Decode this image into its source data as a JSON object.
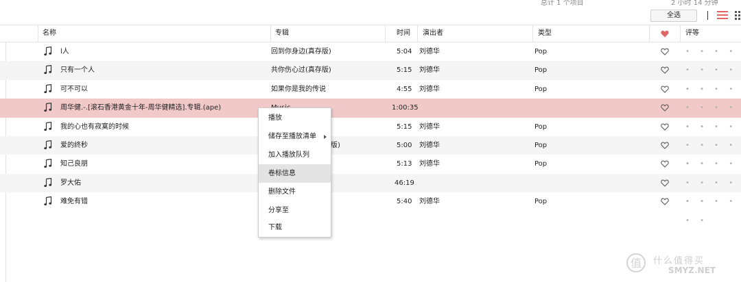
{
  "topbar": {
    "status_left": "总计 1 个项目",
    "status_right": "2 小时 14 分钟",
    "select_all_label": "全选"
  },
  "columns": {
    "name": "名称",
    "album": "专辑",
    "time": "时间",
    "artist": "演出者",
    "genre": "类型",
    "rating": "评等"
  },
  "rows": [
    {
      "title": "l人",
      "album": "回到你身边(真存版)",
      "time": "5:04",
      "artist": "刘德华",
      "genre": "Pop"
    },
    {
      "title": "只有一个人",
      "album": "共你伤心过(真存版)",
      "time": "5:15",
      "artist": "刘德华",
      "genre": "Pop"
    },
    {
      "title": "可不可以",
      "album": "如果你是我的传说",
      "time": "4:55",
      "artist": "刘德华",
      "genre": "Pop"
    },
    {
      "title": "周华健.-.[滚石香港黄金十年-周华健精选].专辑.(ape)",
      "album": "Music",
      "time": "1:00:35",
      "artist": "",
      "genre": ""
    },
    {
      "title": "我的心也有寂寞的时候",
      "album": "",
      "time": "5:15",
      "artist": "刘德华",
      "genre": "Pop"
    },
    {
      "title": "爱的终秒",
      "album": "版)",
      "time": "5:00",
      "artist": "刘德华",
      "genre": "Pop"
    },
    {
      "title": "知己良朋",
      "album": "",
      "time": "5:13",
      "artist": "刘德华",
      "genre": "Pop"
    },
    {
      "title": "罗大佑",
      "album": "",
      "time": "46:19",
      "artist": "",
      "genre": ""
    },
    {
      "title": "难免有错",
      "album": "",
      "time": "5:40",
      "artist": "刘德华",
      "genre": "Pop"
    }
  ],
  "rating_dots": "• • • • • •",
  "context_menu": {
    "items": [
      "播放",
      "储存至播放清单",
      "加入播放队列",
      "卷标信息",
      "删除文件",
      "分享至",
      "下载"
    ]
  },
  "watermark": {
    "text1": "什么值得买",
    "text2": "SMYZ.NET"
  },
  "colors": {
    "accent": "#e06565",
    "highlight_row": "#f2c9c9"
  }
}
